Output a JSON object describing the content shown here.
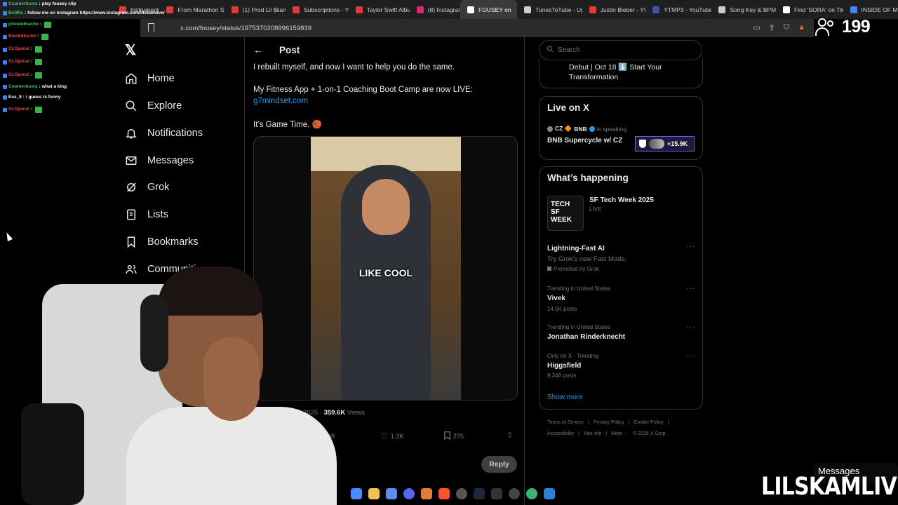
{
  "browser": {
    "tabs": [
      {
        "label": "Instruments",
        "color": "#e53935"
      },
      {
        "label": "From Marathon Stre",
        "color": "#e53935"
      },
      {
        "label": "(1) Prod Lil $kam -",
        "color": "#e53935"
      },
      {
        "label": "Subscriptions - You",
        "color": "#e53935"
      },
      {
        "label": "Taylor Swift Album",
        "color": "#e53935"
      },
      {
        "label": "(8) Instagram",
        "color": "#d62976"
      },
      {
        "label": "FOUSEY on",
        "color": "#ffffff",
        "active": true
      },
      {
        "label": "TunesToTube - Uplo",
        "color": "#cccccc"
      },
      {
        "label": "Justin Bieber - YUK",
        "color": "#e53935"
      },
      {
        "label": "YTMP3 - YouTube to",
        "color": "#3f51b5"
      },
      {
        "label": "Song Key & BPM Fi",
        "color": "#cccccc"
      },
      {
        "label": "Find 'SORA' on TikTo",
        "color": "#ffffff"
      },
      {
        "label": "INSIDE OF MO",
        "color": "#4285f4"
      }
    ],
    "url": "x.com/fousey/status/1975370208996159839"
  },
  "chat": [
    {
      "user": "Coomerkums",
      "text": "play fousey clip",
      "user_color": "#2bd35a"
    },
    {
      "user": "BotRix",
      "text": "follow me on instagram https://www.instagram.com/lilskamlive/",
      "user_color": "#2bd35a"
    },
    {
      "user": "priestofnacho",
      "text": "",
      "user_color": "#2bd35a"
    },
    {
      "user": "BlackSkarlet",
      "text": "",
      "user_color": "#ff3b3b"
    },
    {
      "user": "SLGjamal",
      "text": "",
      "user_color": "#ff3b3b"
    },
    {
      "user": "SLGjamal",
      "text": "",
      "user_color": "#ff3b3b"
    },
    {
      "user": "SLGjamal",
      "text": "",
      "user_color": "#ff3b3b"
    },
    {
      "user": "Coomerkums",
      "text": "what a king",
      "user_color": "#2bd35a"
    },
    {
      "user": "Ess_9",
      "text": "i guess ts funny",
      "user_color": "#ffffff"
    },
    {
      "user": "SLGjamal",
      "text": "",
      "user_color": "#ff3b3b"
    }
  ],
  "nav": {
    "items": [
      {
        "label": "Home",
        "icon": "home-icon"
      },
      {
        "label": "Explore",
        "icon": "search-icon"
      },
      {
        "label": "Notifications",
        "icon": "bell-icon"
      },
      {
        "label": "Messages",
        "icon": "mail-icon"
      },
      {
        "label": "Grok",
        "icon": "grok-icon"
      },
      {
        "label": "Lists",
        "icon": "list-icon"
      },
      {
        "label": "Bookmarks",
        "icon": "bookmark-icon"
      },
      {
        "label": "Communiti",
        "icon": "people-icon"
      }
    ]
  },
  "post": {
    "title": "Post",
    "line1": "I rebuilt myself, and now I want to help you do the same.",
    "line2": "My Fitness App + 1-on-1 Coaching Boot Camp are now LIVE:",
    "link": "g7mindset.com",
    "line3": "It’s Game Time. 🏀",
    "caption": "LIKE COOL",
    "date": "Oct 6, 2025 · ",
    "views": "359.6K",
    "views_label": " Views",
    "retweets": "68",
    "likes": "1.3K",
    "bookmarks": "275",
    "reply_placeholder": "ly",
    "reply_button": "Reply"
  },
  "right": {
    "search_placeholder": "Search",
    "promo_text": "Debut | Oct 18 ⬇️ Start Your Transformation",
    "live_title": "Live on X",
    "live_host1": "CZ 🔶",
    "live_host2": "BNB",
    "live_speaking": "is speaking",
    "live_name": "BNB Supercycle w/ CZ",
    "live_listeners": "+15.9K",
    "happening_title": "What’s happening",
    "trends": [
      {
        "context": "",
        "name": "SF Tech Week 2025",
        "sub": "LIVE"
      },
      {
        "context": "",
        "name": "Lightning-Fast AI",
        "sub": "Try Grok's new Fast Mode.",
        "promo": "Promoted by Grok"
      },
      {
        "context": "Trending in United States",
        "name": "Vivek",
        "sub": "14.5K posts"
      },
      {
        "context": "Trending in United States",
        "name": "Jonathan Rinderknecht",
        "sub": ""
      },
      {
        "context": "Only on X · Trending",
        "name": "Higgsfield",
        "sub": "9,348 posts"
      }
    ],
    "thumb_text": "TECH SF WEEK",
    "show_more": "Show more",
    "footer1": [
      "Terms of Service",
      "|",
      "Privacy Policy",
      "|",
      "Cookie Policy",
      "|"
    ],
    "footer2": [
      "Accessibility",
      "|",
      "Ads info",
      "|",
      "More ···",
      "© 2025 X Corp."
    ]
  },
  "overlay": {
    "viewer_count": "199",
    "messages_label": "Messages",
    "brand": "LILSKAMLIVE"
  }
}
